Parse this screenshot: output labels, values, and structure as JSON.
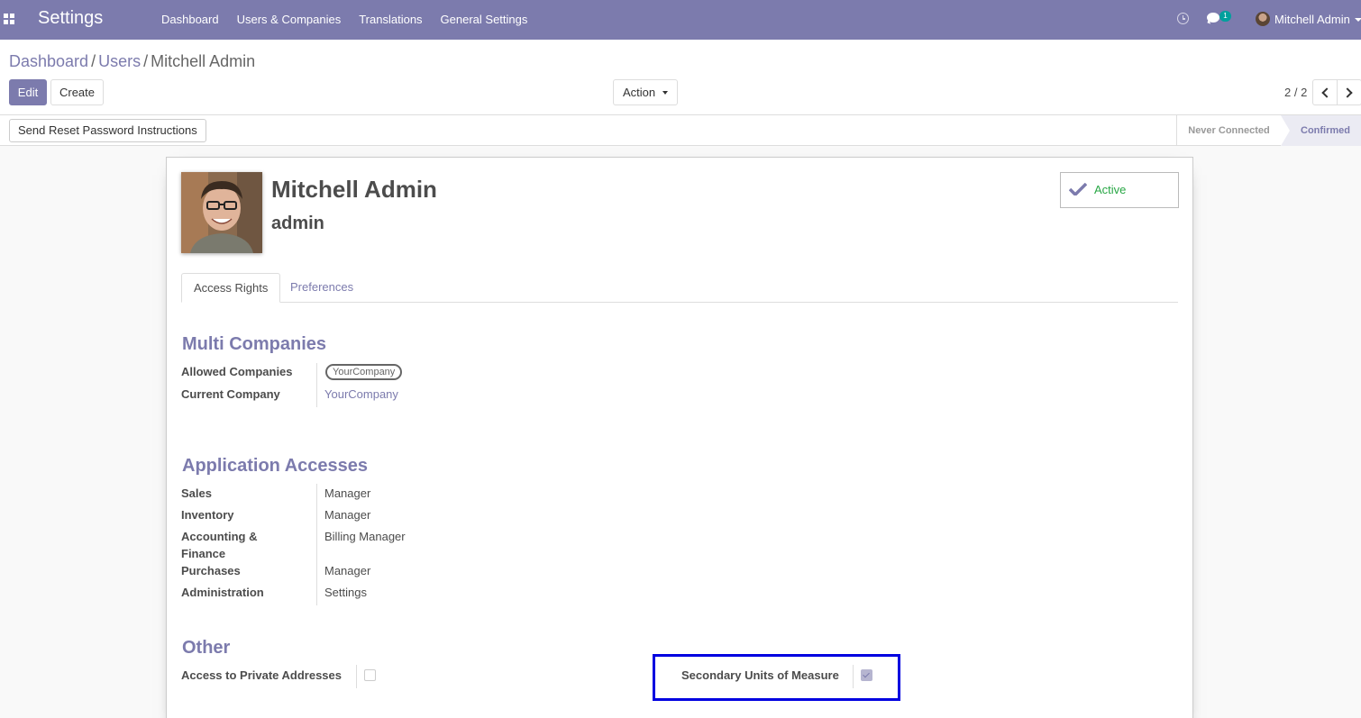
{
  "navbar": {
    "app_title": "Settings",
    "menu": [
      "Dashboard",
      "Users & Companies",
      "Translations",
      "General Settings"
    ],
    "chat_badge": "1",
    "user_name": "Mitchell Admin",
    "bg_color": "#7c7bad"
  },
  "breadcrumb": {
    "items": [
      "Dashboard",
      "Users"
    ],
    "current": "Mitchell Admin"
  },
  "buttons": {
    "edit": "Edit",
    "create": "Create",
    "action": "Action",
    "reset_password": "Send Reset Password Instructions"
  },
  "pager": {
    "value": "2 / 2"
  },
  "status": {
    "stages": [
      "Never Connected",
      "Confirmed"
    ],
    "current": "Confirmed"
  },
  "user": {
    "name": "Mitchell Admin",
    "login": "admin",
    "active_label": "Active",
    "active_color": "#28a745"
  },
  "tabs": [
    "Access Rights",
    "Preferences"
  ],
  "sections": {
    "multi_companies": {
      "title": "Multi Companies",
      "fields": [
        {
          "label": "Allowed Companies",
          "value": "YourCompany"
        },
        {
          "label": "Current Company",
          "value": "YourCompany"
        }
      ]
    },
    "application_accesses": {
      "title": "Application Accesses",
      "fields": [
        {
          "label": "Sales",
          "value": "Manager"
        },
        {
          "label": "Inventory",
          "value": "Manager"
        },
        {
          "label": "Accounting & Finance",
          "value": "Billing Manager"
        },
        {
          "label": "Purchases",
          "value": "Manager"
        },
        {
          "label": "Administration",
          "value": "Settings"
        }
      ]
    },
    "other": {
      "title": "Other",
      "fields": [
        {
          "label": "Access to Private Addresses",
          "checked": false
        },
        {
          "label": "Secondary Units of Measure",
          "checked": true
        }
      ]
    }
  }
}
